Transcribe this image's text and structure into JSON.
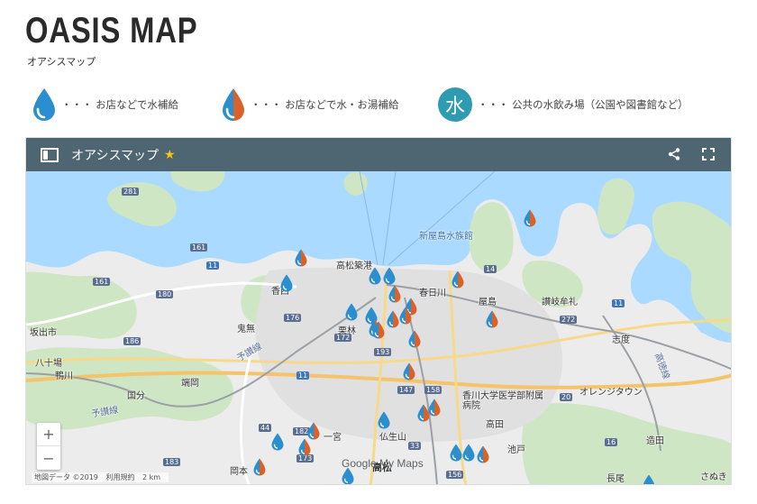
{
  "page": {
    "title": "OASIS MAP",
    "subtitle": "オアシスマップ"
  },
  "legend": [
    {
      "icon": "blue-drop-icon",
      "text": "・・・ お店などで水補給"
    },
    {
      "icon": "blue-orange-drop-icon",
      "text": "・・・ お店などで水・お湯補給"
    },
    {
      "icon": "water-kanji-icon",
      "kanji": "水",
      "text": "・・・ 公共の水飲み場（公園や図書館など）"
    }
  ],
  "map": {
    "title": "オアシスマップ",
    "star": "★",
    "zoom_in": "+",
    "zoom_out": "−",
    "attribution": [
      "地図データ ©2019",
      "利用規約",
      "2 km"
    ],
    "google": "Google My Maps",
    "colors": {
      "water": "#aadaff",
      "land": "#e8e8e8",
      "green": "#cfe6c4",
      "blue_pin": "#2b8fcf",
      "orange_pin": "#d9622b"
    },
    "place_labels": [
      {
        "id": "shinyashima-aquarium",
        "text": "新屋島水族館"
      },
      {
        "id": "takamatsu-port",
        "text": "高松築港"
      },
      {
        "id": "kasuga",
        "text": "春日川"
      },
      {
        "id": "yashima",
        "text": "屋島"
      },
      {
        "id": "sanuki-mure",
        "text": "讃岐牟礼"
      },
      {
        "id": "sakaide",
        "text": "坂出市"
      },
      {
        "id": "hachiman",
        "text": "八十場"
      },
      {
        "id": "kamogawa",
        "text": "鴨川"
      },
      {
        "id": "kinashi",
        "text": "鬼無"
      },
      {
        "id": "kokubu",
        "text": "国分"
      },
      {
        "id": "hashioka",
        "text": "端岡"
      },
      {
        "id": "yosan-line",
        "text": "予讃線"
      },
      {
        "id": "yosan-line-2",
        "text": "予讃線"
      },
      {
        "id": "kagawa-univ",
        "text": "香川大学医学部附属病院"
      },
      {
        "id": "takada",
        "text": "高田"
      },
      {
        "id": "ikenobe",
        "text": "池戸"
      },
      {
        "id": "orange-town",
        "text": "オレンジタウン"
      },
      {
        "id": "shido",
        "text": "志度"
      },
      {
        "id": "zoda",
        "text": "造田"
      },
      {
        "id": "nagao",
        "text": "長尾"
      },
      {
        "id": "okamoto",
        "text": "岡本"
      },
      {
        "id": "busshozan",
        "text": "仏生山"
      },
      {
        "id": "ichinomiya",
        "text": "一宮"
      },
      {
        "id": "takamatsu",
        "text": "高松"
      },
      {
        "id": "kozai",
        "text": "香西"
      },
      {
        "id": "kotoden",
        "text": "高徳線"
      },
      {
        "id": "sanuki",
        "text": "さぬき"
      },
      {
        "id": "kuribayashi",
        "text": "栗林"
      }
    ],
    "route_numbers": [
      "281",
      "161",
      "161",
      "180",
      "186",
      "176",
      "11",
      "172",
      "11",
      "193",
      "14",
      "158",
      "272",
      "11",
      "147",
      "20",
      "44",
      "182",
      "33",
      "183",
      "173",
      "16",
      "156"
    ],
    "pins": [
      {
        "type": "orange"
      },
      {
        "type": "orange"
      },
      {
        "type": "blue"
      },
      {
        "type": "blue"
      },
      {
        "type": "blue"
      },
      {
        "type": "orange"
      },
      {
        "type": "orange"
      },
      {
        "type": "blue"
      },
      {
        "type": "orange"
      },
      {
        "type": "blue"
      },
      {
        "type": "orange"
      },
      {
        "type": "orange"
      },
      {
        "type": "orange"
      },
      {
        "type": "orange"
      },
      {
        "type": "orange"
      },
      {
        "type": "orange"
      },
      {
        "type": "orange"
      },
      {
        "type": "orange"
      },
      {
        "type": "blue"
      },
      {
        "type": "orange"
      },
      {
        "type": "blue"
      },
      {
        "type": "orange"
      },
      {
        "type": "orange"
      },
      {
        "type": "blue"
      },
      {
        "type": "blue"
      },
      {
        "type": "orange"
      },
      {
        "type": "blue"
      },
      {
        "type": "blue"
      },
      {
        "type": "orange"
      }
    ]
  }
}
